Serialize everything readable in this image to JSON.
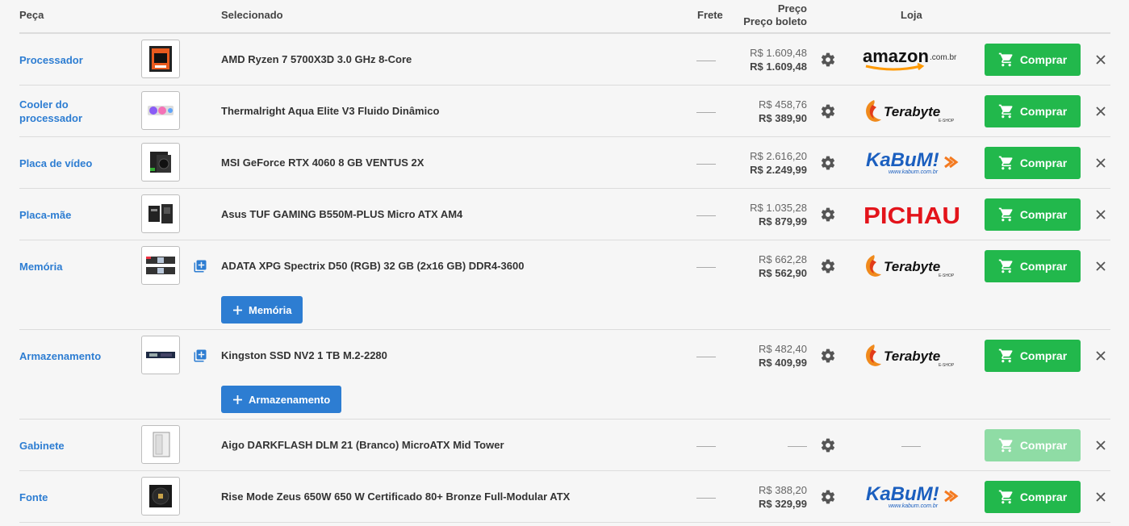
{
  "header": {
    "peca": "Peça",
    "selecionado": "Selecionado",
    "frete": "Frete",
    "preco": "Preço",
    "preco_boleto": "Preço boleto",
    "loja": "Loja"
  },
  "buy_label": "Comprar",
  "rows": [
    {
      "part": "Processador",
      "product": "AMD Ryzen 7 5700X3D 3.0 GHz 8-Core",
      "price": "R$ 1.609,48",
      "price_boleto": "R$ 1.609,48",
      "store": "amazon"
    },
    {
      "part": "Cooler do processador",
      "product": "Thermalright Aqua Elite V3 Fluido Dinâmico",
      "price": "R$ 458,76",
      "price_boleto": "R$ 389,90",
      "store": "terabyte"
    },
    {
      "part": "Placa de vídeo",
      "product": "MSI GeForce RTX 4060 8 GB VENTUS 2X",
      "price": "R$ 2.616,20",
      "price_boleto": "R$ 2.249,99",
      "store": "kabum"
    },
    {
      "part": "Placa-mãe",
      "product": "Asus TUF GAMING B550M-PLUS Micro ATX AM4",
      "price": "R$ 1.035,28",
      "price_boleto": "R$ 879,99",
      "store": "pichau"
    },
    {
      "part": "Memória",
      "product": "ADATA XPG Spectrix D50 (RGB) 32 GB (2x16 GB) DDR4-3600",
      "price": "R$ 662,28",
      "price_boleto": "R$ 562,90",
      "store": "terabyte",
      "add_label": "Memória"
    },
    {
      "part": "Armazenamento",
      "product": "Kingston SSD NV2 1 TB M.2-2280",
      "price": "R$ 482,40",
      "price_boleto": "R$ 409,99",
      "store": "terabyte",
      "add_label": "Armazenamento"
    },
    {
      "part": "Gabinete",
      "product": "Aigo DARKFLASH DLM 21 (Branco) MicroATX Mid Tower",
      "price": "",
      "price_boleto": "",
      "store": ""
    },
    {
      "part": "Fonte",
      "product": "Rise Mode Zeus 650W 650 W Certificado 80+ Bronze Full-Modular ATX",
      "price": "R$ 388,20",
      "price_boleto": "R$ 329,99",
      "store": "kabum"
    }
  ],
  "stores": {
    "amazon": {
      "name": "amazon",
      "suffix": ".com.br"
    },
    "terabyte": {
      "name": "Terabyte",
      "suffix": "E-SHOP"
    },
    "kabum": {
      "name": "KaBuM!",
      "suffix": "www.kabum.com.br"
    },
    "pichau": {
      "name": "PICHAU"
    }
  },
  "colors": {
    "link": "#2d7dd2",
    "buy": "#22b84c",
    "buy_disabled": "#8fdca5",
    "add_button": "#2d7dd2"
  }
}
